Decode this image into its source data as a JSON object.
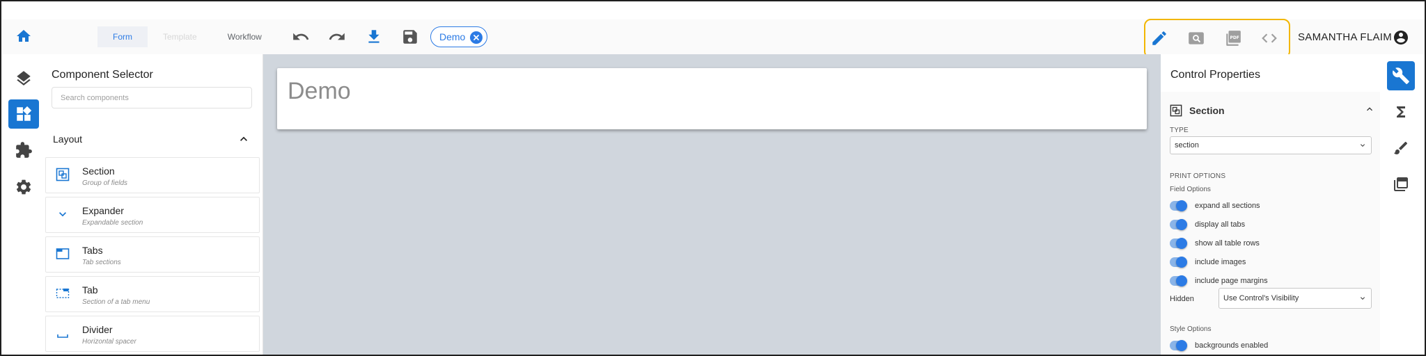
{
  "toolbar": {
    "mode_tabs": [
      {
        "label": "Form"
      },
      {
        "label": "Template"
      },
      {
        "label": "Workflow"
      }
    ],
    "chip_label": "Demo",
    "user_name": "SAMANTHA FLAIM",
    "view_modes": [
      "edit",
      "preview",
      "pdf",
      "code"
    ]
  },
  "selector": {
    "title": "Component Selector",
    "search_placeholder": "Search components",
    "group_label": "Layout",
    "items": [
      {
        "name": "Section",
        "desc": "Group of fields",
        "icon": "section-icon"
      },
      {
        "name": "Expander",
        "desc": "Expandable section",
        "icon": "chevron-down-icon"
      },
      {
        "name": "Tabs",
        "desc": "Tab sections",
        "icon": "tabs-icon"
      },
      {
        "name": "Tab",
        "desc": "Section of a tab menu",
        "icon": "tab-icon"
      },
      {
        "name": "Divider",
        "desc": "Horizontal spacer",
        "icon": "divider-icon"
      }
    ]
  },
  "canvas": {
    "form_title": "Demo"
  },
  "props": {
    "title": "Control Properties",
    "section_name": "Section",
    "type_label": "TYPE",
    "type_value": "section",
    "print_options_label": "PRINT OPTIONS",
    "field_options_label": "Field Options",
    "toggles": [
      {
        "label": "expand all sections",
        "on": true
      },
      {
        "label": "display all tabs",
        "on": true
      },
      {
        "label": "show all table rows",
        "on": true
      },
      {
        "label": "include images",
        "on": true
      },
      {
        "label": "include page margins",
        "on": true
      }
    ],
    "hidden_label": "Hidden",
    "hidden_value": "Use Control's Visibility",
    "style_options_label": "Style Options",
    "style_toggles": [
      {
        "label": "backgrounds enabled",
        "on": true
      }
    ]
  },
  "colors": {
    "accent": "#2c7be5",
    "rail_active": "#1976d2",
    "highlight_box": "#f2b600",
    "canvas_bg": "#d0d6dd"
  }
}
